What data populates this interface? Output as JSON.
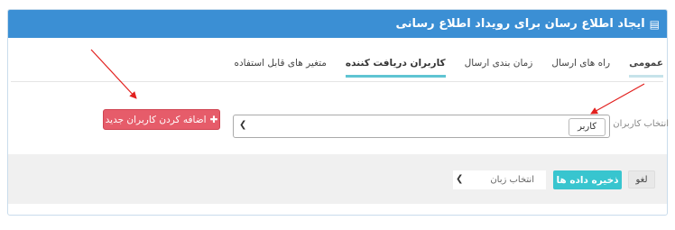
{
  "header": {
    "title": "ایجاد اطلاع رسان برای رویداد اطلاع رسانی",
    "icon": "list-icon"
  },
  "tabs": [
    {
      "label": "عمومی",
      "state": "first"
    },
    {
      "label": "راه های ارسال",
      "state": "normal"
    },
    {
      "label": "زمان بندی ارسال",
      "state": "normal"
    },
    {
      "label": "کاربران دریافت کننده",
      "state": "active"
    },
    {
      "label": "متغیر های قابل استفاده",
      "state": "normal"
    }
  ],
  "users": {
    "label": "انتخاب کاربران",
    "selected_tag": "کاربر"
  },
  "add_button": {
    "icon": "plus-icon",
    "label": "اضافه کردن کاربران جدید"
  },
  "footer": {
    "cancel_label": "لغو",
    "save_label": "ذخیره داده ها",
    "language_select": "انتخاب زبان"
  },
  "colors": {
    "header_bg": "#3b8fd4",
    "save_button": "#38c5cf",
    "add_button": "#e65c6a",
    "annotation_arrow": "#e2201e"
  }
}
